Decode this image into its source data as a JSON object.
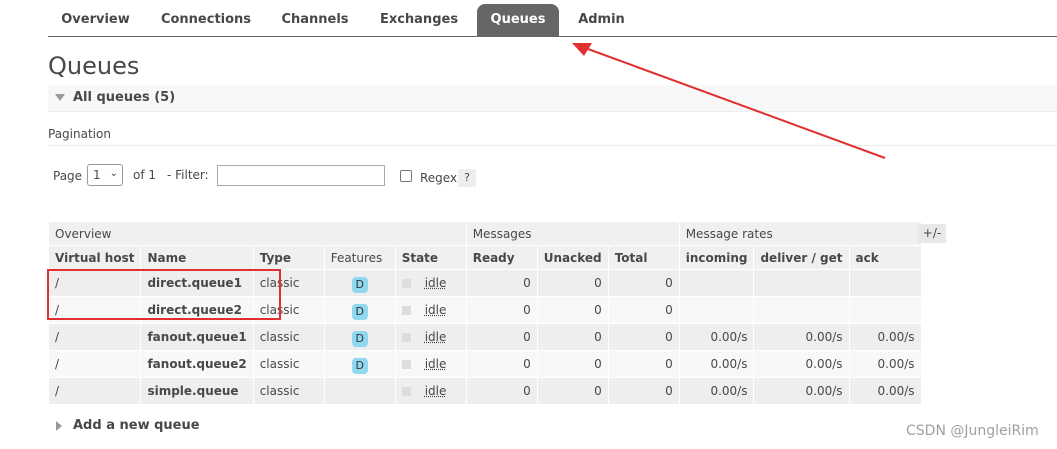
{
  "nav": {
    "tabs": [
      {
        "label": "Overview"
      },
      {
        "label": "Connections"
      },
      {
        "label": "Channels"
      },
      {
        "label": "Exchanges"
      },
      {
        "label": "Queues",
        "active": true
      },
      {
        "label": "Admin"
      }
    ]
  },
  "page_title": "Queues",
  "section": {
    "label": "All queues (5)"
  },
  "pagination": {
    "title": "Pagination",
    "page_label": "Page",
    "page_value": "1",
    "of_label": "of 1",
    "filter_label": "- Filter:",
    "filter_value": "",
    "regex_label": "Regex",
    "help_label": "?"
  },
  "table": {
    "groups": [
      "Overview",
      "Messages",
      "Message rates"
    ],
    "columns": [
      "Virtual host",
      "Name",
      "Type",
      "Features",
      "State",
      "Ready",
      "Unacked",
      "Total",
      "incoming",
      "deliver / get",
      "ack"
    ],
    "plus_minus": "+/-",
    "rows": [
      {
        "vhost": "/",
        "name": "direct.queue1",
        "type": "classic",
        "feature": "D",
        "state": "idle",
        "ready": "0",
        "unacked": "0",
        "total": "0",
        "incoming": "",
        "deliver": "",
        "ack": ""
      },
      {
        "vhost": "/",
        "name": "direct.queue2",
        "type": "classic",
        "feature": "D",
        "state": "idle",
        "ready": "0",
        "unacked": "0",
        "total": "0",
        "incoming": "",
        "deliver": "",
        "ack": ""
      },
      {
        "vhost": "/",
        "name": "fanout.queue1",
        "type": "classic",
        "feature": "D",
        "state": "idle",
        "ready": "0",
        "unacked": "0",
        "total": "0",
        "incoming": "0.00/s",
        "deliver": "0.00/s",
        "ack": "0.00/s"
      },
      {
        "vhost": "/",
        "name": "fanout.queue2",
        "type": "classic",
        "feature": "D",
        "state": "idle",
        "ready": "0",
        "unacked": "0",
        "total": "0",
        "incoming": "0.00/s",
        "deliver": "0.00/s",
        "ack": "0.00/s"
      },
      {
        "vhost": "/",
        "name": "simple.queue",
        "type": "classic",
        "feature": "",
        "state": "idle",
        "ready": "0",
        "unacked": "0",
        "total": "0",
        "incoming": "0.00/s",
        "deliver": "0.00/s",
        "ack": "0.00/s"
      }
    ]
  },
  "add_queue": {
    "label": "Add a new queue"
  },
  "watermark": "CSDN @JungleiRim",
  "colors": {
    "nav_active_bg": "#666666",
    "annotation_red": "#e03030",
    "feature_badge": "#90d8f0"
  }
}
